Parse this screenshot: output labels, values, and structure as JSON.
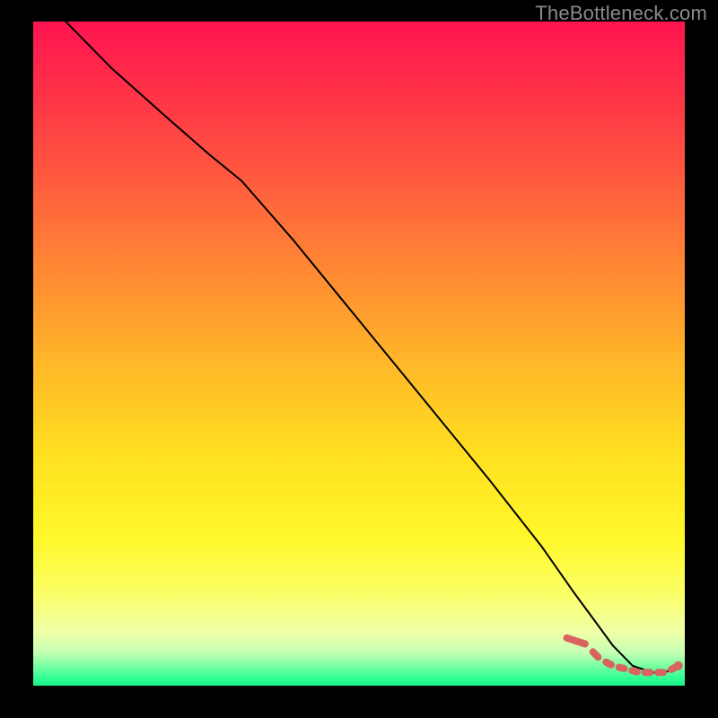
{
  "watermark": "TheBottleneck.com",
  "colors": {
    "background": "#000000",
    "watermark_text": "#8a8a8a",
    "curve": "#000000",
    "marker": "#d9645f",
    "gradient_stops": [
      "#ff1450",
      "#ff2a4a",
      "#ff5540",
      "#ff8a33",
      "#ffb928",
      "#ffe220",
      "#fff82a",
      "#fbff66",
      "#efffa8",
      "#c5ffb4",
      "#66ff9e",
      "#2cff91",
      "#1aef8c"
    ]
  },
  "chart_data": {
    "type": "line",
    "title": "",
    "xlabel": "",
    "ylabel": "",
    "xlim": [
      0,
      100
    ],
    "ylim": [
      0,
      100
    ],
    "series": [
      {
        "name": "bottleneck-curve",
        "style": "line",
        "x": [
          5,
          12,
          20,
          27,
          32,
          40,
          50,
          60,
          70,
          78,
          83,
          86,
          89,
          92,
          95,
          97,
          99
        ],
        "values": [
          100,
          93,
          86,
          80,
          76,
          67,
          55,
          43,
          31,
          21,
          14,
          10,
          6,
          3,
          2,
          2,
          3
        ]
      },
      {
        "name": "highlight-dashes",
        "style": "dashed-markers",
        "x": [
          83,
          85,
          87,
          89,
          91,
          93,
          95,
          97,
          99
        ],
        "values": [
          8,
          6,
          4,
          3,
          2.5,
          2,
          2,
          2,
          3
        ]
      }
    ]
  }
}
